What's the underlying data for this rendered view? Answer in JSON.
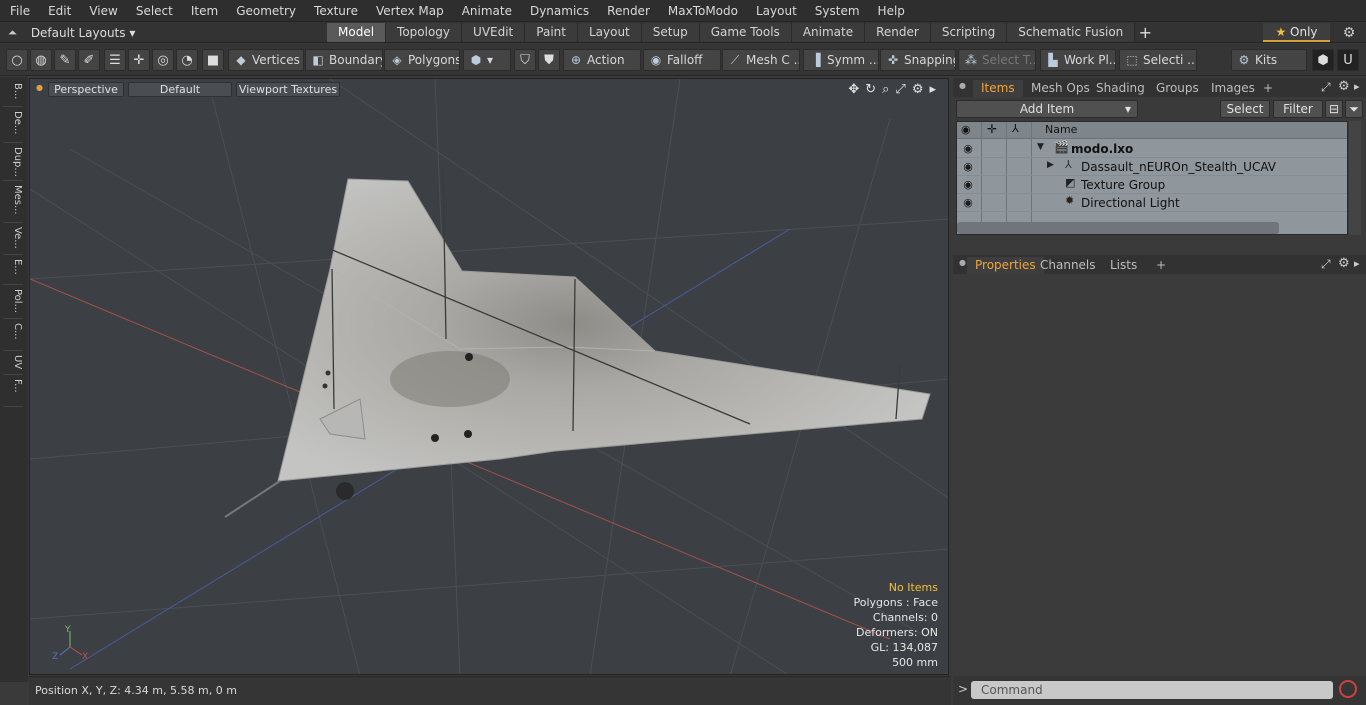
{
  "menu": [
    "File",
    "Edit",
    "View",
    "Select",
    "Item",
    "Geometry",
    "Texture",
    "Vertex Map",
    "Animate",
    "Dynamics",
    "Render",
    "MaxToModo",
    "Layout",
    "System",
    "Help"
  ],
  "layout_selector": "Default Layouts ▾",
  "tabs": [
    "Model",
    "Topology",
    "UVEdit",
    "Paint",
    "Layout",
    "Setup",
    "Game Tools",
    "Animate",
    "Render",
    "Scripting",
    "Schematic Fusion"
  ],
  "only_label": "Only",
  "toolbar": {
    "vertices": "Vertices",
    "boundary": "Boundary",
    "polygons": "Polygons",
    "action": "Action",
    "falloff": "Falloff",
    "mesh_c": "Mesh C ...",
    "symm": "Symm ...",
    "snapping": "Snapping",
    "select_t": "Select T...",
    "work_pl": "Work Pl...",
    "selecti": "Selecti ...",
    "kits": "Kits"
  },
  "left_tabs": [
    "B...",
    "De...",
    "Dup...",
    "Mes...",
    "Ve...",
    "E...",
    "Pol...",
    "C...",
    "UV",
    "F..."
  ],
  "viewport": {
    "view": "Perspective",
    "shading": "Default",
    "textures": "Viewport Textures",
    "stats": {
      "items": "No Items",
      "polygons": "Polygons : Face",
      "channels": "Channels: 0",
      "deformers": "Deformers: ON",
      "gl": "GL: 134,087",
      "scale": "500 mm"
    }
  },
  "status": "Position X, Y, Z:   4.34 m, 5.58 m, 0 m",
  "right_tabs": [
    "Items",
    "Mesh Ops",
    "Shading",
    "Groups",
    "Images"
  ],
  "items_toolbar": {
    "add_item": "Add Item",
    "select": "Select",
    "filter": "Filter"
  },
  "tree": {
    "header": "Name",
    "rows": [
      {
        "label": "modo.lxo"
      },
      {
        "label": "Dassault_nEUROn_Stealth_UCAV"
      },
      {
        "label": "Texture Group"
      },
      {
        "label": "Directional Light"
      }
    ]
  },
  "props_tabs": [
    "Properties",
    "Channels",
    "Lists"
  ],
  "command_placeholder": "Command"
}
